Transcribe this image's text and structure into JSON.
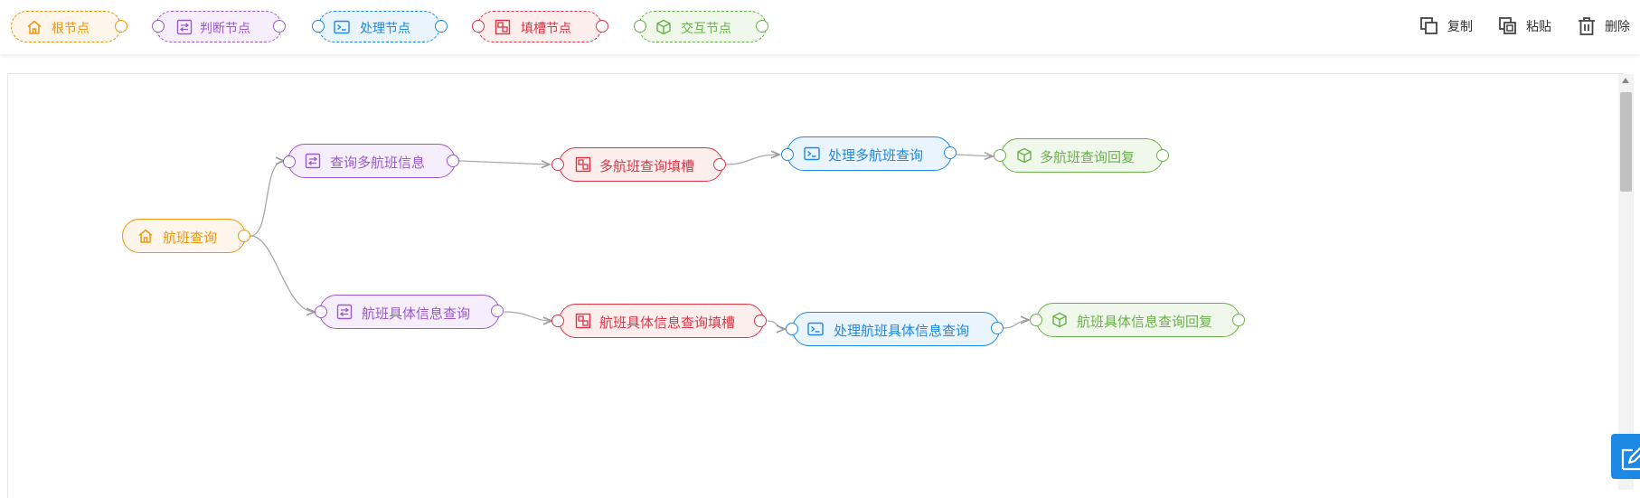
{
  "palette": [
    {
      "label": "根节点",
      "icon": "home-icon",
      "color": "#f0960f"
    },
    {
      "label": "判断节点",
      "icon": "judge-icon",
      "color": "#9b59d0"
    },
    {
      "label": "处理节点",
      "icon": "terminal-icon",
      "color": "#1e88e5"
    },
    {
      "label": "填槽节点",
      "icon": "slot-icon",
      "color": "#dc3545"
    },
    {
      "label": "交互节点",
      "icon": "cube-icon",
      "color": "#6ab04c"
    }
  ],
  "actions": {
    "copy_label": "复制",
    "paste_label": "粘贴",
    "delete_label": "删除"
  },
  "nodes": {
    "root": {
      "label": "航班查询",
      "type": "root"
    },
    "judge1": {
      "label": "查询多航班信息",
      "type": "judge"
    },
    "slot1": {
      "label": "多航班查询填槽",
      "type": "slot"
    },
    "process1": {
      "label": "处理多航班查询",
      "type": "process"
    },
    "interact1": {
      "label": "多航班查询回复",
      "type": "interact"
    },
    "judge2": {
      "label": "航班具体信息查询",
      "type": "judge"
    },
    "slot2": {
      "label": "航班具体信息查询填槽",
      "type": "slot"
    },
    "process2": {
      "label": "处理航班具体信息查询",
      "type": "process"
    },
    "interact2": {
      "label": "航班具体信息查询回复",
      "type": "interact"
    }
  }
}
